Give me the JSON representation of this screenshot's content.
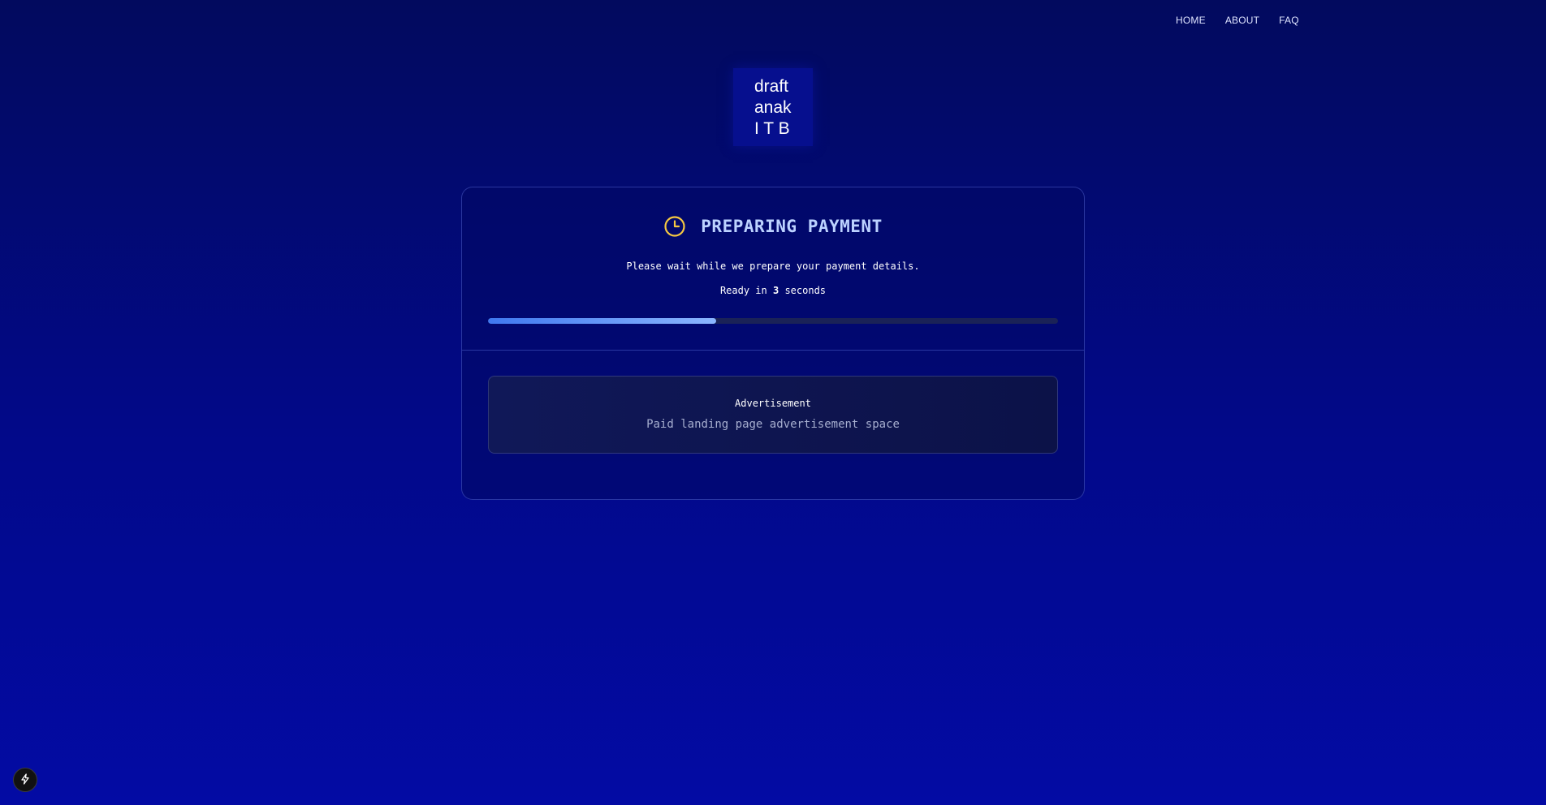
{
  "nav": {
    "items": [
      "HOME",
      "ABOUT",
      "FAQ"
    ]
  },
  "logo": {
    "lines": [
      "draft",
      "anak",
      "I T B"
    ]
  },
  "status": {
    "title": "PREPARING PAYMENT",
    "subtitle": "Please wait while we prepare your payment details.",
    "ready_prefix": "Ready in",
    "ready_seconds": "3",
    "ready_suffix": "seconds",
    "progress_fraction": 0.4,
    "icon": "clock-icon"
  },
  "ad": {
    "label": "Advertisement",
    "text": "Paid landing page advertisement space"
  },
  "colors": {
    "accent": "#8bb6ff",
    "clock": "#f5c842",
    "background": "#02098a"
  },
  "fab": {
    "icon": "bolt-icon"
  }
}
